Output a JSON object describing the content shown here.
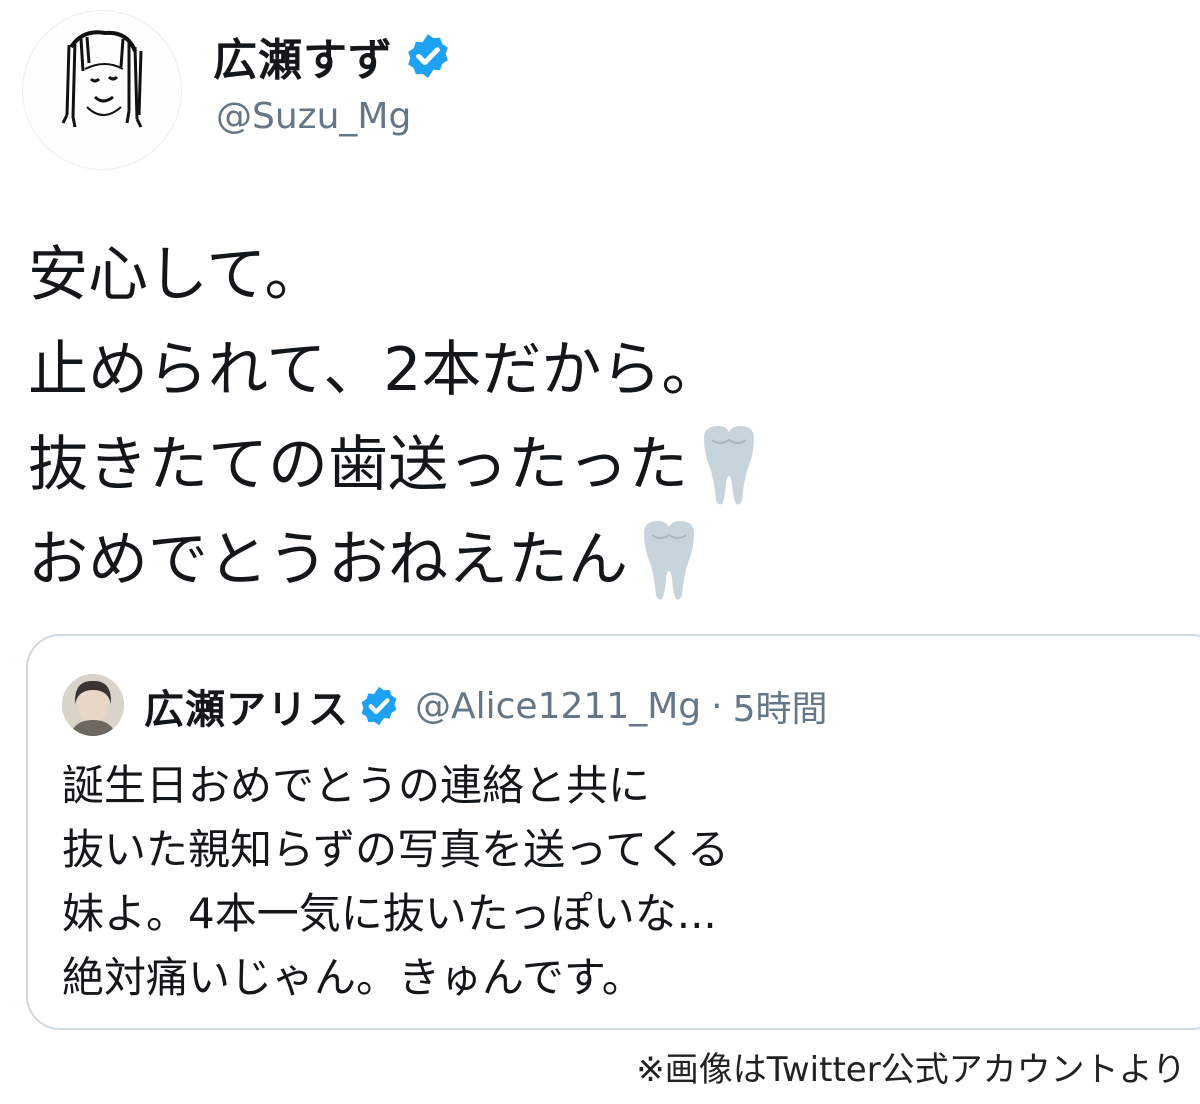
{
  "tweet": {
    "display_name": "広瀬すず",
    "handle": "@Suzu_Mg",
    "lines": [
      "安心して。",
      "止められて、2本だから。",
      "抜きたての歯送ったった",
      "おめでとうおねえたん"
    ],
    "line_emoji": [
      "",
      "",
      "tooth-icon",
      "tooth-icon"
    ]
  },
  "quoted_tweet": {
    "display_name": "広瀬アリス",
    "handle": "@Alice1211_Mg",
    "separator": "·",
    "time": "5時間",
    "lines": [
      "誕生日おめでとうの連絡と共に",
      "抜いた親知らずの写真を送ってくる",
      "妹よ。4本一気に抜いたっぽいな...",
      "絶対痛いじゃん。きゅんです。"
    ]
  },
  "credit": "※画像はTwitter公式アカウントより",
  "colors": {
    "text": "#14171a",
    "secondary_text": "#657786",
    "verified_blue": "#1da1f2",
    "card_border": "#cfd9de",
    "tooth": "#c8d4dc"
  }
}
